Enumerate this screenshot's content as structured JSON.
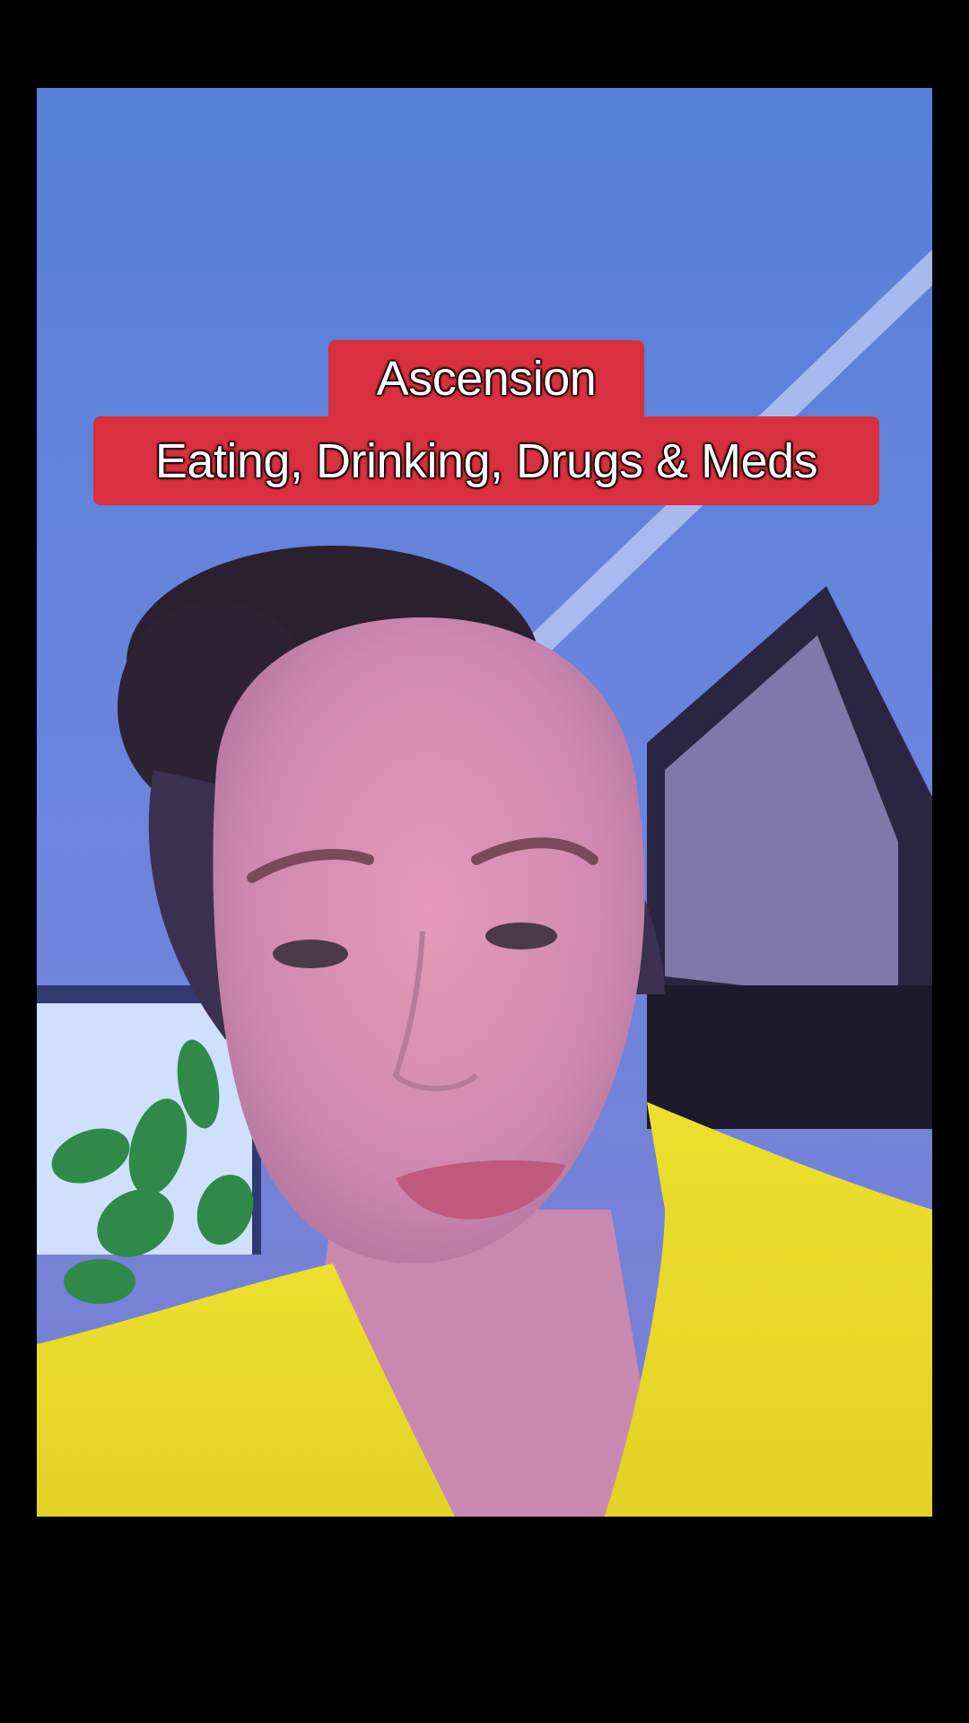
{
  "video": {
    "caption_lines": [
      "Ascension",
      "Eating, Drinking, Drugs & Meds"
    ]
  },
  "colors": {
    "caption_background": "#d8303e",
    "caption_text": "#ffffff",
    "letterbox": "#000000",
    "wall": "#6a86dc",
    "shirt": "#e8dc2a"
  }
}
